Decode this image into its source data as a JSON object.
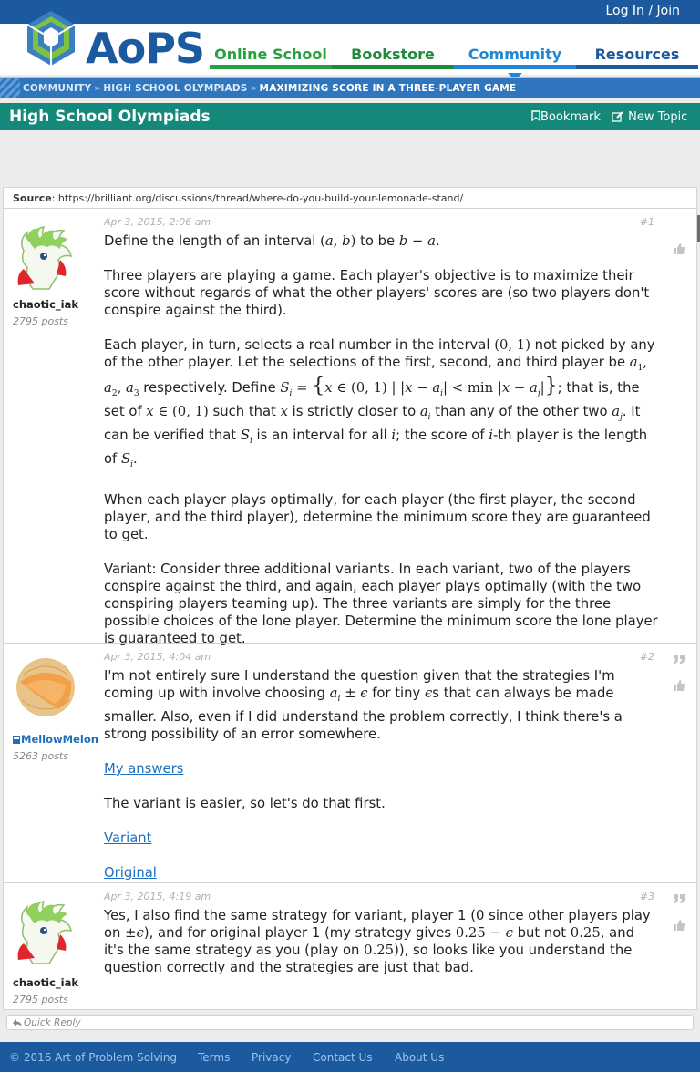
{
  "header": {
    "login_label": "Log In / Join",
    "logo_text": "AoPS",
    "tabs": [
      {
        "label": "Online School"
      },
      {
        "label": "Bookstore"
      },
      {
        "label": "Community"
      },
      {
        "label": "Resources"
      }
    ]
  },
  "breadcrumb": {
    "items": [
      "COMMUNITY",
      "HIGH SCHOOL OLYMPIADS",
      "MAXIMIZING SCORE IN A THREE-PLAYER GAME"
    ],
    "separator": "»"
  },
  "forum": {
    "title": "High School Olympiads",
    "bookmark_label": "Bookmark",
    "new_topic_label": "New Topic"
  },
  "thread": {
    "source_label": "Source",
    "source_url": "https://brilliant.org/discussions/thread/where-do-you-build-your-lemonade-stand/",
    "posts": [
      {
        "username": "chaotic_iak",
        "post_count": "2795 posts",
        "date": "Apr 3, 2015, 2:06 am",
        "number": "#1"
      },
      {
        "username": "MellowMelon",
        "post_count": "5263 posts",
        "date": "Apr 3, 2015, 4:04 am",
        "number": "#2",
        "hide_links": [
          "My answers",
          "Variant",
          "Original"
        ],
        "body_p2": "The variant is easier, so let's do that first."
      },
      {
        "username": "chaotic_iak",
        "post_count": "2795 posts",
        "date": "Apr 3, 2015, 4:19 am",
        "number": "#3"
      }
    ]
  },
  "quick_reply_label": "Quick Reply",
  "footer": {
    "copyright": "© 2016 Art of Problem Solving",
    "links": [
      "Terms",
      "Privacy",
      "Contact Us",
      "About Us"
    ]
  },
  "colors": {
    "brand_blue": "#1b5a9e",
    "online_school_green": "#27a041",
    "bookstore_green": "#1f8a3c",
    "community_blue": "#1e88d6",
    "forum_teal": "#14897a"
  },
  "icons": [
    "aops-logo",
    "bookmark-icon",
    "edit-icon",
    "globe-icon",
    "quote-icon",
    "thumbs-up-icon",
    "reply-icon",
    "shaymin-avatar",
    "cantaloupe-avatar",
    "moderator-shield-icon"
  ]
}
